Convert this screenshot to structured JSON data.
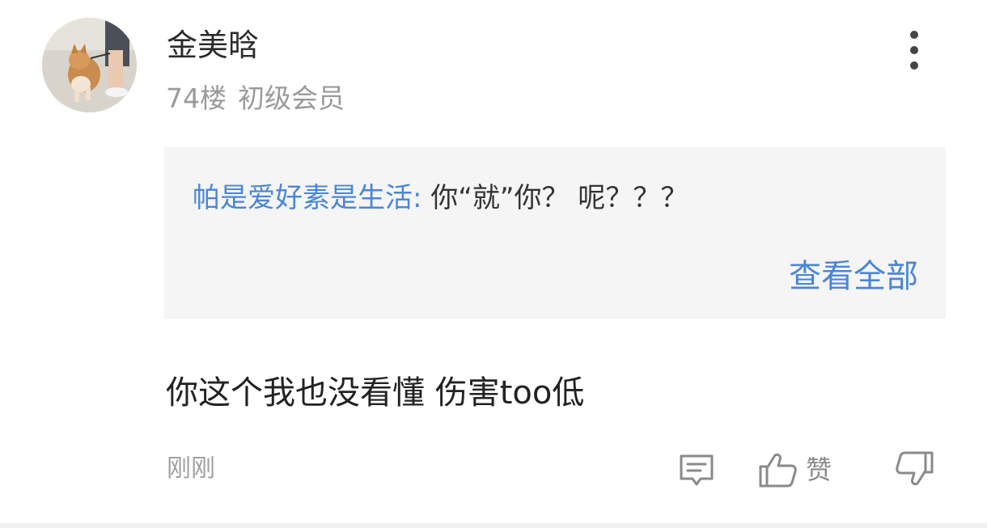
{
  "comment": {
    "username": "金美晗",
    "floor": "74楼",
    "level": "初级会员",
    "quote": {
      "author": "帕是爱好素是生活:",
      "text": "你“就”你？ 呢？？？",
      "view_all_label": "查看全部"
    },
    "text": "你这个我也没看懂 伤害too低",
    "timestamp": "刚刚",
    "like_label": "赞"
  },
  "icons": {
    "more": "more-vertical-icon",
    "reply": "comment-icon",
    "like": "thumbs-up-icon",
    "dislike": "thumbs-down-icon"
  },
  "colors": {
    "link_blue": "#4a86d6",
    "muted_gray": "#9a9a9a",
    "quote_bg": "#f5f5f5"
  }
}
